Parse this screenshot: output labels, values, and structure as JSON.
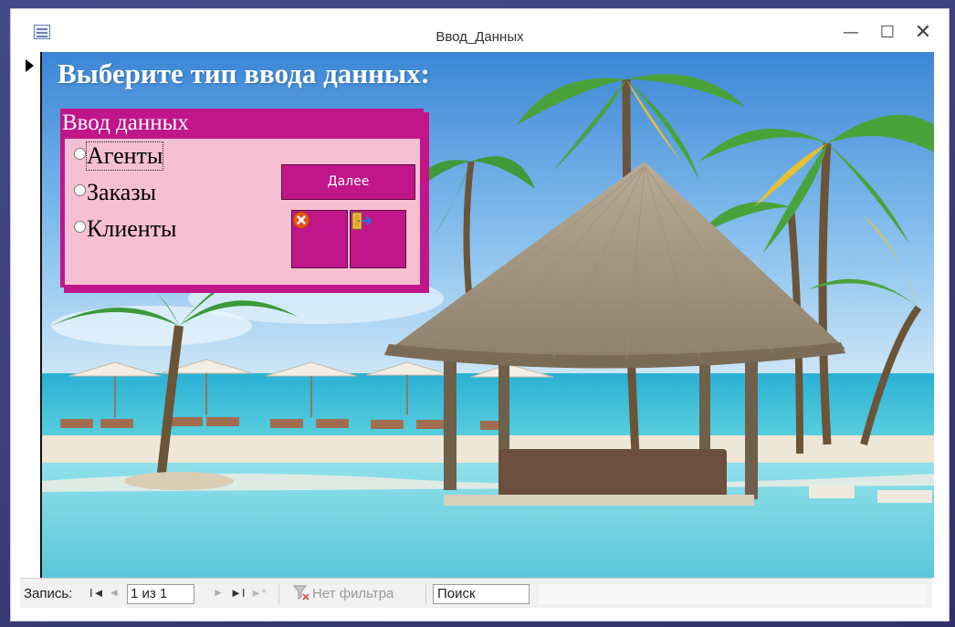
{
  "window": {
    "title": "Ввод_Данных",
    "controls": {
      "minimize": "—",
      "maximize": "☐",
      "close": "✕"
    }
  },
  "form": {
    "heading": "Выберите тип ввода данных:",
    "frame_title": "Ввод данных",
    "options": [
      {
        "label": "Агенты",
        "selected": false,
        "focused": true
      },
      {
        "label": "Заказы",
        "selected": false,
        "focused": false
      },
      {
        "label": "Клиенты",
        "selected": false,
        "focused": false
      }
    ],
    "next_button": "Далее",
    "cancel_icon": "cancel-icon",
    "exit_icon": "exit-door-icon"
  },
  "navigation": {
    "record_label": "Запись:",
    "first_glyph": "I◄",
    "prev_glyph": "◄",
    "record_value": "1 из 1",
    "next_glyph": "►",
    "last_glyph": "►I",
    "new_glyph": "►*",
    "filter_label": "Нет фильтра",
    "search_placeholder": "Поиск"
  },
  "colors": {
    "accent": "#c0168a",
    "frame_background": "#f7bfd2"
  }
}
